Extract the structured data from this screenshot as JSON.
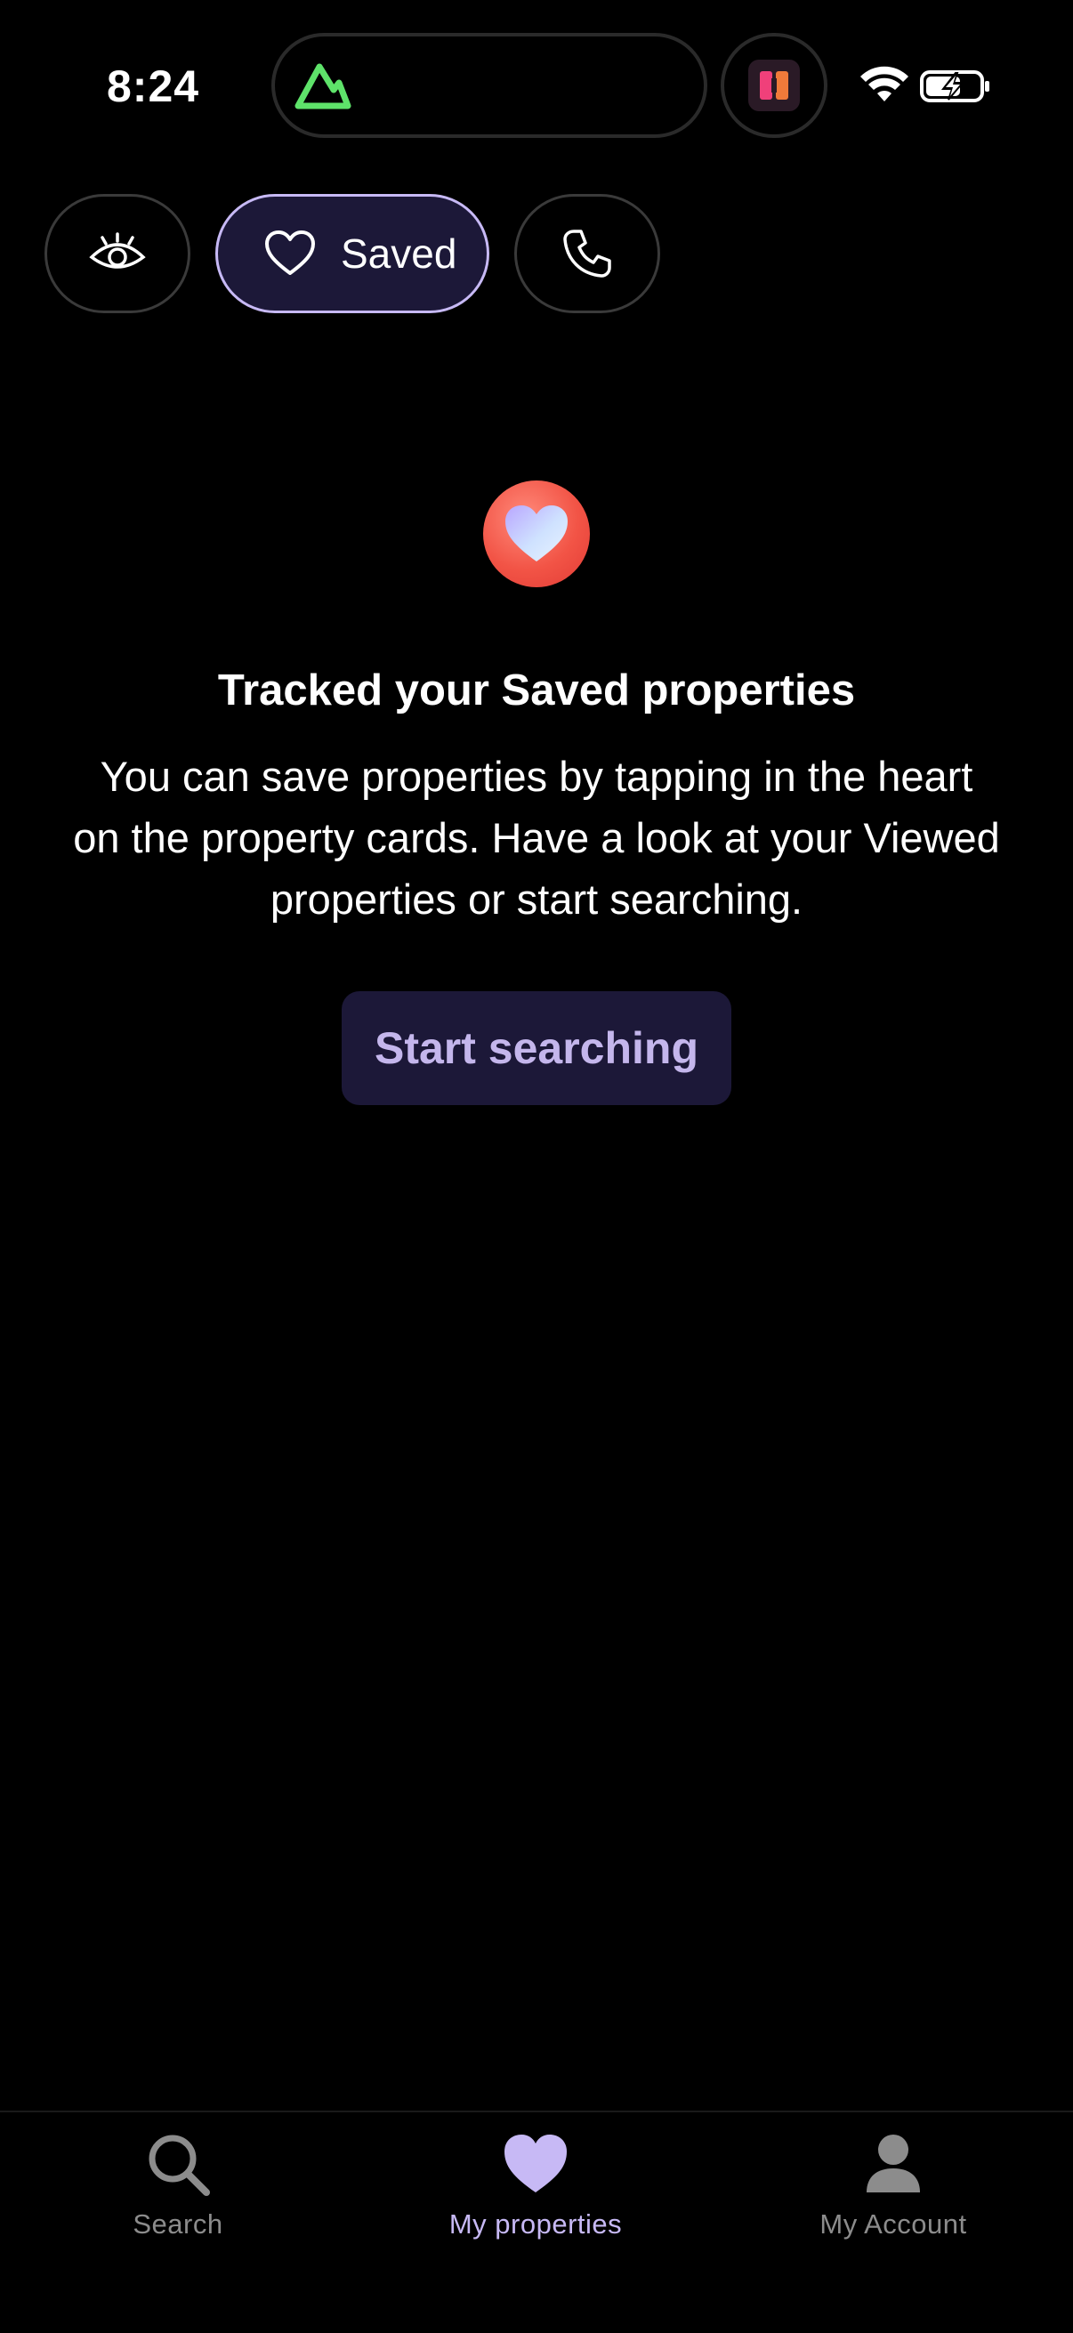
{
  "status_bar": {
    "time": "8:24"
  },
  "filters": {
    "saved_label": "Saved"
  },
  "empty_state": {
    "title": "Tracked your Saved properties",
    "description": "You can save properties by tapping in the heart on the property cards. Have a look at your Viewed properties or start searching.",
    "button_label": "Start searching"
  },
  "bottom_nav": {
    "items": [
      {
        "label": "Search",
        "icon": "search-icon"
      },
      {
        "label": "My properties",
        "icon": "heart-icon",
        "active": true
      },
      {
        "label": "My Account",
        "icon": "person-icon"
      }
    ]
  },
  "colors": {
    "accent": "#c7b9f5",
    "chip_active_bg": "#1c1838",
    "heart_badge": "#f25446",
    "live_activity_green": "#5ee36a"
  }
}
